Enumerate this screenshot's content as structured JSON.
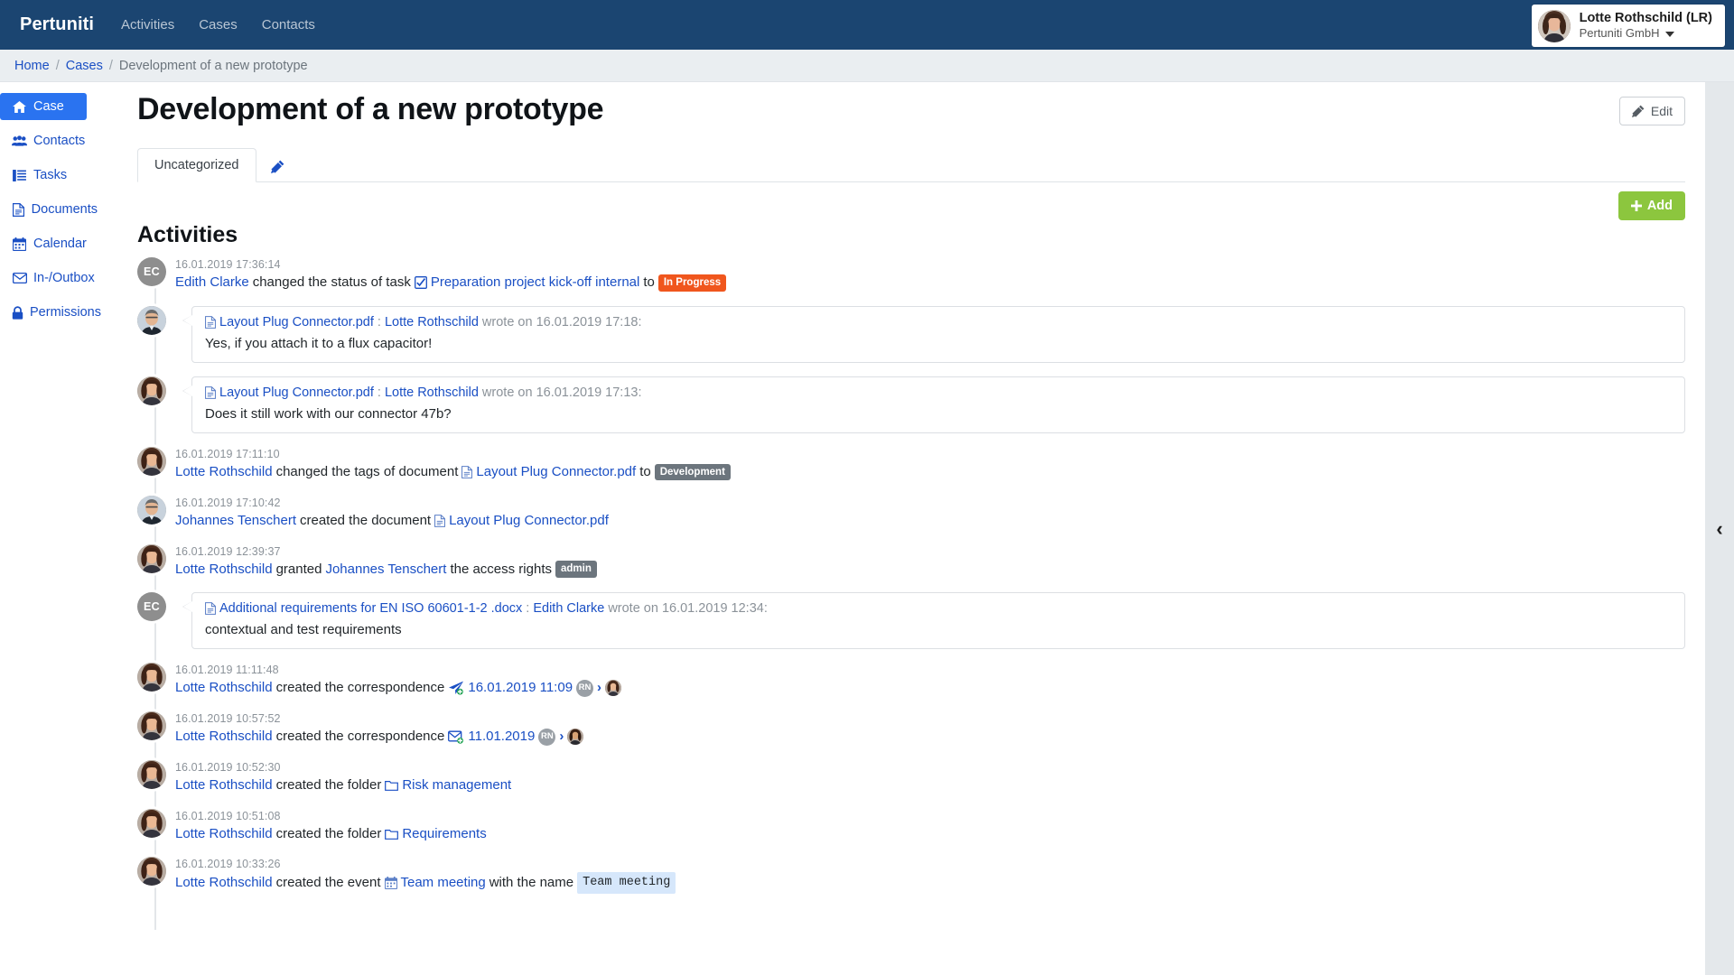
{
  "app": {
    "brand": "Pertuniti",
    "nav": [
      {
        "label": "Activities"
      },
      {
        "label": "Cases"
      },
      {
        "label": "Contacts"
      }
    ],
    "user": {
      "name": "Lotte Rothschild (LR)",
      "org": "Pertuniti GmbH"
    }
  },
  "breadcrumb": {
    "home": "Home",
    "cases": "Cases",
    "current": "Development of a new prototype",
    "sep": "/"
  },
  "sidebar": {
    "items": [
      {
        "label": "Case",
        "icon": "home-icon"
      },
      {
        "label": "Contacts",
        "icon": "users-icon"
      },
      {
        "label": "Tasks",
        "icon": "list-icon"
      },
      {
        "label": "Documents",
        "icon": "document-icon"
      },
      {
        "label": "Calendar",
        "icon": "calendar-icon"
      },
      {
        "label": "In-/Outbox",
        "icon": "envelope-icon"
      },
      {
        "label": "Permissions",
        "icon": "lock-icon"
      }
    ]
  },
  "page": {
    "title": "Development of a new prototype",
    "edit_label": "Edit",
    "add_label": "Add",
    "tab_label": "Uncategorized",
    "section_title": "Activities"
  },
  "colors": {
    "navbar": "#1b4571",
    "link": "#1a4fc4",
    "sidebar_active": "#2a73f0",
    "add_button": "#8cc63e",
    "badge_in_progress": "#f0561d",
    "badge_grey": "#6c757d",
    "code_chip": "#d6e7fb"
  },
  "activities": [
    {
      "kind": "status",
      "avatar": "initials",
      "initials": "EC",
      "timestamp": "16.01.2019 17:36:14",
      "actor": "Edith Clarke",
      "verb": "changed the status of task",
      "target": "Preparation project kick-off internal",
      "target_icon": "checkbox-icon",
      "tail": "to",
      "badge": "In Progress",
      "badge_style": "orange"
    },
    {
      "kind": "comment",
      "avatar": "photo-male",
      "doc": "Layout Plug Connector.pdf",
      "doc_icon": "document-icon",
      "author": "Lotte Rothschild",
      "head_mid": ":",
      "head_tail": "wrote on 16.01.2019 17:18:",
      "text": "Yes, if you attach it to a flux capacitor!"
    },
    {
      "kind": "comment",
      "avatar": "photo-female",
      "doc": "Layout Plug Connector.pdf",
      "doc_icon": "document-icon",
      "author": "Lotte Rothschild",
      "head_mid": ":",
      "head_tail": "wrote on 16.01.2019 17:13:",
      "text": "Does it still work with our connector 47b?"
    },
    {
      "kind": "tags",
      "avatar": "photo-female",
      "timestamp": "16.01.2019 17:11:10",
      "actor": "Lotte Rothschild",
      "verb": "changed the tags of document",
      "target": "Layout Plug Connector.pdf",
      "target_icon": "document-icon",
      "tail": "to",
      "badge": "Development",
      "badge_style": "grey"
    },
    {
      "kind": "created-doc",
      "avatar": "photo-male",
      "timestamp": "16.01.2019 17:10:42",
      "actor": "Johannes Tenschert",
      "verb": "created the document",
      "target": "Layout Plug Connector.pdf",
      "target_icon": "document-icon"
    },
    {
      "kind": "granted",
      "avatar": "photo-female",
      "timestamp": "16.01.2019 12:39:37",
      "actor": "Lotte Rothschild",
      "verb": "granted",
      "actor2": "Johannes Tenschert",
      "verb2": "the access rights",
      "badge": "admin",
      "badge_style": "grey"
    },
    {
      "kind": "comment",
      "avatar": "initials",
      "initials": "EC",
      "doc": "Additional requirements for EN ISO 60601-1-2 .docx",
      "doc_icon": "document-icon",
      "author": "Edith Clarke",
      "head_mid": ":",
      "head_tail": "wrote on 16.01.2019 12:34:",
      "text": "contextual and test requirements"
    },
    {
      "kind": "correspondence",
      "avatar": "photo-female",
      "timestamp": "16.01.2019 11:11:48",
      "actor": "Lotte Rothschild",
      "verb": "created the correspondence",
      "corr_icon": "paper-plane-icon",
      "target": "16.01.2019 11:09",
      "from_initials": "RN",
      "arrow": "›",
      "to_avatar": "photo-female"
    },
    {
      "kind": "correspondence",
      "avatar": "photo-female",
      "timestamp": "16.01.2019 10:57:52",
      "actor": "Lotte Rothschild",
      "verb": "created the correspondence",
      "corr_icon": "envelope-in-icon",
      "target": "11.01.2019",
      "from_initials": "RN",
      "arrow": "›",
      "to_avatar": "photo-female"
    },
    {
      "kind": "folder",
      "avatar": "photo-female",
      "timestamp": "16.01.2019 10:52:30",
      "actor": "Lotte Rothschild",
      "verb": "created the folder",
      "target": "Risk management",
      "target_icon": "folder-icon"
    },
    {
      "kind": "folder",
      "avatar": "photo-female",
      "timestamp": "16.01.2019 10:51:08",
      "actor": "Lotte Rothschild",
      "verb": "created the folder",
      "target": "Requirements",
      "target_icon": "folder-icon"
    },
    {
      "kind": "event",
      "avatar": "photo-female",
      "timestamp": "16.01.2019 10:33:26",
      "actor": "Lotte Rothschild",
      "verb": "created the event",
      "target": "Team meeting",
      "target_icon": "calendar-icon",
      "tail": "with the name",
      "code": "Team meeting"
    }
  ],
  "collapse_handle": "‹"
}
